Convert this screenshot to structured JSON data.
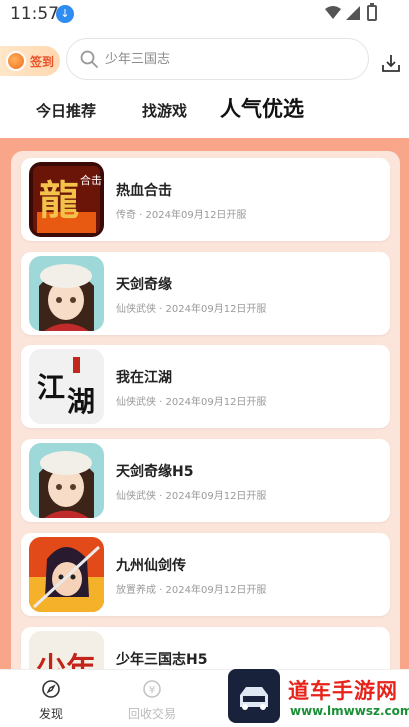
{
  "status_bar": {
    "time": "11:57",
    "download_icon": "download-badge-icon"
  },
  "header": {
    "signin_label": "签到",
    "search_placeholder": "少年三国志"
  },
  "tabs": [
    {
      "label": "今日推荐"
    },
    {
      "label": "找游戏"
    },
    {
      "label": "人气优选",
      "active": true
    }
  ],
  "games": [
    {
      "title": "热血合击",
      "subtitle": "传奇 · 2024年09月12日开服",
      "icon": "dragon-game-icon"
    },
    {
      "title": "天剑奇缘",
      "subtitle": "仙侠武侠 · 2024年09月12日开服",
      "icon": "anime-girl-game-icon"
    },
    {
      "title": "我在江湖",
      "subtitle": "仙侠武侠 · 2024年09月12日开服",
      "icon": "jianghu-calligraphy-icon"
    },
    {
      "title": "天剑奇缘H5",
      "subtitle": "仙侠武侠 · 2024年09月12日开服",
      "icon": "anime-girl-game-icon"
    },
    {
      "title": "九州仙剑传",
      "subtitle": "放置养成 · 2024年09月12日开服",
      "icon": "swordsman-game-icon"
    },
    {
      "title": "少年三国志H5",
      "subtitle": "",
      "icon": "three-kingdoms-game-icon"
    }
  ],
  "bottom_nav": [
    {
      "label": "发现",
      "icon": "discover-icon"
    },
    {
      "label": "回收交易",
      "icon": "recycle-yen-icon"
    }
  ],
  "watermark": {
    "text": "道车手游网",
    "url": "www.lmwwsz.com"
  },
  "colors": {
    "panel_bg": "#f9a58a",
    "panel_inner": "#fbe4da",
    "accent": "#e8542a"
  }
}
